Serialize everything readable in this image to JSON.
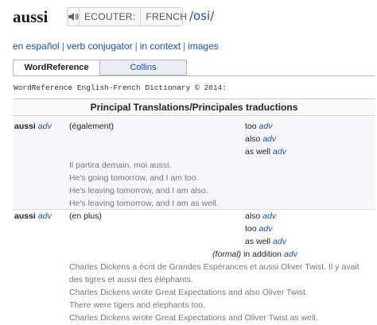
{
  "header": {
    "headword": "aussi",
    "audio": {
      "speaker_icon": "speaker-icon",
      "ecouter_label": "ECOUTER:",
      "language_label": "FRENCH"
    },
    "phonetic": "/osi/"
  },
  "links": {
    "espanol": "en español",
    "conjugator": "verb conjugator",
    "context": "in context",
    "images": "images",
    "separator": "|"
  },
  "tabs": [
    {
      "label": "WordReference"
    },
    {
      "label": "Collins"
    }
  ],
  "copyright": "WordReference English-French Dictionary © 2014:",
  "section_title": "Principal Translations/Principales traductions",
  "entries": [
    {
      "term": "aussi",
      "pos": "adv",
      "note": "(également)",
      "translations": [
        {
          "word": "too",
          "pos": "adv"
        },
        {
          "word": "also",
          "pos": "adv"
        },
        {
          "word": "as well",
          "pos": "adv"
        }
      ],
      "examples": [
        "Il partira demain, moi aussi.",
        "He's going tomorrow, and I am too.",
        "He's leaving tomorrow, and I am also.",
        "He's leaving tomorrow, and I am as well."
      ]
    },
    {
      "term": "aussi",
      "pos": "adv",
      "note": "(en plus)",
      "translations": [
        {
          "word": "also",
          "pos": "adv"
        },
        {
          "word": "too",
          "pos": "adv"
        },
        {
          "word": "as well",
          "pos": "adv"
        },
        {
          "qualifier": "(formal)",
          "word": "in addition",
          "pos": "adv"
        }
      ],
      "examples": [
        "Charles Dickens a écrit de Grandes Espérances et aussi Oliver Twist. Il y avait",
        "des tigres et aussi des éléphants.",
        "Charles Dickens wrote Great Expectations and also Oliver Twist.",
        "There were tigers and elephants too.",
        "Charles Dickens wrote Great Expectations and Oliver Twist as well."
      ]
    }
  ]
}
